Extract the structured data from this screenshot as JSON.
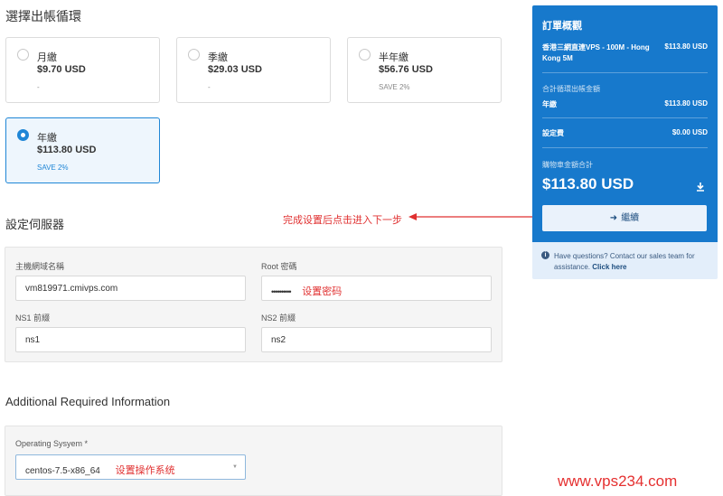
{
  "billing": {
    "title": "選擇出帳循環",
    "options": [
      {
        "name": "月繳",
        "price": "$9.70 USD",
        "save": "-"
      },
      {
        "name": "季繳",
        "price": "$29.03 USD",
        "save": "-"
      },
      {
        "name": "半年繳",
        "price": "$56.76 USD",
        "save": "SAVE 2%"
      },
      {
        "name": "年繳",
        "price": "$113.80 USD",
        "save": "SAVE 2%",
        "selected": true
      }
    ]
  },
  "server": {
    "title": "設定伺服器",
    "hostname_label": "主機網域名稱",
    "hostname_value": "vm819971.cmivps.com",
    "root_label": "Root 密碼",
    "root_value": "••••••••••",
    "ns1_label": "NS1 前綴",
    "ns1_value": "ns1",
    "ns2_label": "NS2 前綴",
    "ns2_value": "ns2"
  },
  "additional": {
    "title": "Additional Required Information",
    "os_label": "Operating Sysyem *",
    "os_value": "centos-7.5-x86_64"
  },
  "annotations": {
    "next_step": "完成设置后点击进入下一步",
    "set_password": "设置密码",
    "set_os": "设置操作系统"
  },
  "order_summary": {
    "title": "訂單概觀",
    "product": "香港三網直連VPS - 100M - Hong Kong 5M",
    "product_price": "$113.80 USD",
    "recurring_label": "合計循環出帳金額",
    "cycle_label": "年繳",
    "cycle_price": "$113.80 USD",
    "setup_label": "設定費",
    "setup_price": "$0.00 USD",
    "total_label": "購物車金額合計",
    "total": "$113.80 USD",
    "continue_label": "繼續"
  },
  "help": {
    "text": "Have questions? Contact our sales team for assistance.",
    "link": "Click here"
  },
  "watermark": "www.vps234.com",
  "colors": {
    "accent": "#1779cc",
    "annotation": "#e03030"
  }
}
